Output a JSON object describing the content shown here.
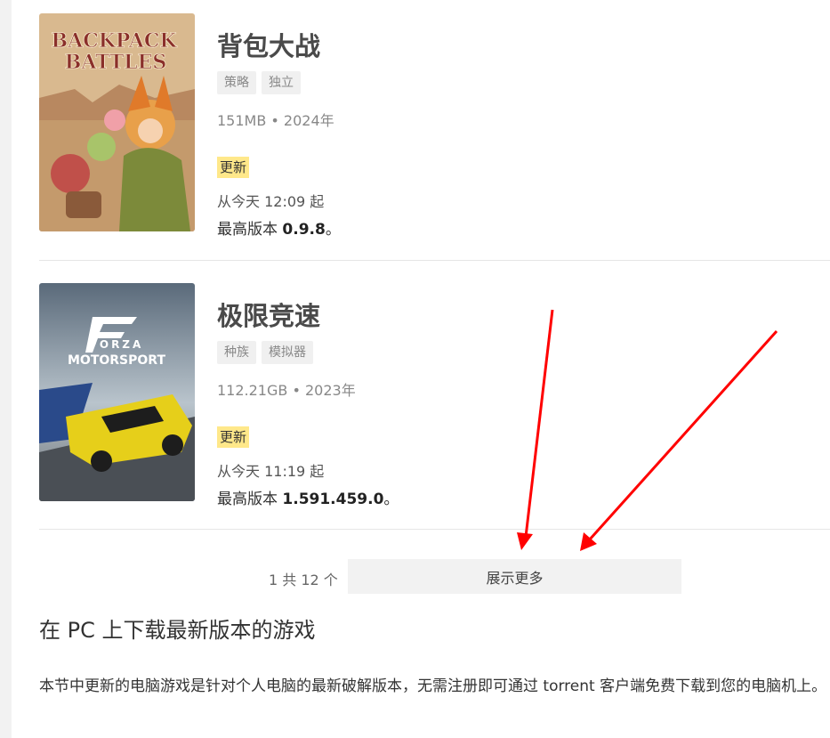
{
  "games": [
    {
      "title": "背包大战",
      "tags": [
        "策略",
        "独立"
      ],
      "meta": "151MB • 2024年",
      "badge": "更新",
      "since": "从今天 12:09 起",
      "version_prefix": "最高版本 ",
      "version": "0.9.8",
      "version_suffix": "。",
      "cover_text_1": "BACKPACK",
      "cover_text_2": "BATTLES"
    },
    {
      "title": "极限竞速",
      "tags": [
        "种族",
        "模拟器"
      ],
      "meta": "112.21GB • 2023年",
      "badge": "更新",
      "since": "从今天 11:19 起",
      "version_prefix": "最高版本 ",
      "version": "1.591.459.0",
      "version_suffix": "。",
      "cover_text_1": "FORZA",
      "cover_text_2": "MOTORSPORT"
    }
  ],
  "pagination": {
    "count_text": "1 共 12 个",
    "more_label": "展示更多"
  },
  "section": {
    "title": "在 PC 上下载最新版本的游戏",
    "text": "本节中更新的电脑游戏是针对个人电脑的最新破解版本，无需注册即可通过 torrent 客户端免费下载到您的电脑机上。"
  },
  "colors": {
    "badge": "#ffe88a",
    "arrow": "#ff0000",
    "tag_bg": "#f0f0f0",
    "button_bg": "#f2f2f2"
  }
}
